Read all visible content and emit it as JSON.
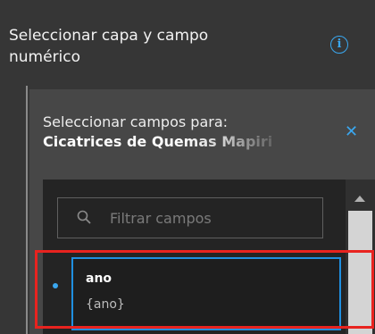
{
  "header": {
    "title": "Seleccionar capa y campo numérico",
    "info_icon": "info-icon"
  },
  "panel": {
    "label": "Seleccionar campos para:",
    "layer_name": "Cicatrices de Quemas Mapiri",
    "close_icon": "close-icon"
  },
  "search": {
    "placeholder": "Filtrar campos",
    "value": "",
    "icon": "search-icon"
  },
  "fields": [
    {
      "name": "ano",
      "alias": "{ano}",
      "selected": true
    }
  ],
  "annotation": {
    "highlight_color": "#e8231f"
  },
  "colors": {
    "accent": "#3aa7ef",
    "background": "#363636",
    "panel": "#474747",
    "list": "#242424"
  }
}
